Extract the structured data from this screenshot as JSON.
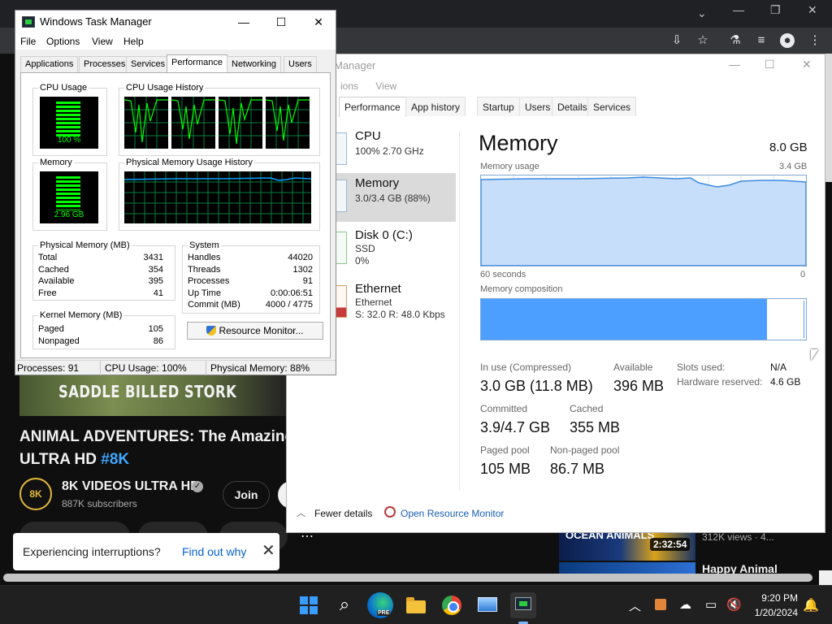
{
  "chrome": {
    "window_controls": [
      "⌄",
      "—",
      "❐",
      "✕"
    ],
    "toolbar_icons": [
      "install-icon",
      "star-icon",
      "lab-icon",
      "playlist-icon",
      "profile-icon",
      "menu-icon"
    ]
  },
  "youtube": {
    "video_caption": "SADDLE BILLED STORK",
    "title_main": "ANIMAL ADVENTURES: The Amazing",
    "title_line2": "ULTRA HD ",
    "title_tag": "#8K",
    "channel_avatar": "8K",
    "channel_name": "8K VIDEOS ULTRA HD",
    "channel_subs": "887K subscribers",
    "join_label": "Join",
    "more_label": "⋯",
    "toast_text": "Experiencing interruptions?",
    "toast_link": "Find out why",
    "rec_thumb_text": "OCEAN ANIMALS",
    "rec_duration": "2:32:54",
    "rec_views": "312K views · 4...",
    "rec_title2": "Happy Animal"
  },
  "tm_modern": {
    "title": "Manager",
    "menu": [
      "ions",
      "View"
    ],
    "tabs": [
      "Performance",
      "App history",
      "Startup",
      "Users",
      "Details",
      "Services"
    ],
    "sidebar": [
      {
        "name": "CPU",
        "sub1": "100%  2.70 GHz",
        "sub2": ""
      },
      {
        "name": "Memory",
        "sub1": "3.0/3.4 GB (88%)",
        "sub2": ""
      },
      {
        "name": "Disk 0 (C:)",
        "sub1": "SSD",
        "sub2": "0%"
      },
      {
        "name": "Ethernet",
        "sub1": "Ethernet",
        "sub2": "S: 32.0  R: 48.0 Kbps"
      }
    ],
    "heading": "Memory",
    "total": "8.0 GB",
    "usage_label": "Memory usage",
    "usage_max": "3.4 GB",
    "x_left": "60 seconds",
    "x_right": "0",
    "composition_label": "Memory composition",
    "composition_in_use_fraction": 0.88,
    "stats": {
      "in_use_label": "In use (Compressed)",
      "in_use_value": "3.0 GB (11.8 MB)",
      "available_label": "Available",
      "available_value": "396 MB",
      "committed_label": "Committed",
      "committed_value": "3.9/4.7 GB",
      "cached_label": "Cached",
      "cached_value": "355 MB",
      "paged_label": "Paged pool",
      "paged_value": "105 MB",
      "nonpaged_label": "Non-paged pool",
      "nonpaged_value": "86.7 MB",
      "slots_label": "Slots used:",
      "slots_value": "N/A",
      "hw_reserved_label": "Hardware reserved:",
      "hw_reserved_value": "4.6 GB"
    },
    "fewer_details": "Fewer details",
    "open_resource_monitor": "Open Resource Monitor"
  },
  "tm_classic": {
    "title": "Windows Task Manager",
    "window_buttons": [
      "—",
      "☐",
      "✕"
    ],
    "menu": [
      "File",
      "Options",
      "View",
      "Help"
    ],
    "tabs": [
      "Applications",
      "Processes",
      "Services",
      "Performance",
      "Networking",
      "Users"
    ],
    "cpu_usage_label": "CPU Usage",
    "cpu_usage_value": "100 %",
    "cpu_history_label": "CPU Usage History",
    "memory_label": "Memory",
    "memory_value": "2.96 GB",
    "mem_history_label": "Physical Memory Usage History",
    "physical_memory": {
      "title": "Physical Memory (MB)",
      "rows": [
        {
          "label": "Total",
          "value": "3431"
        },
        {
          "label": "Cached",
          "value": "354"
        },
        {
          "label": "Available",
          "value": "395"
        },
        {
          "label": "Free",
          "value": "41"
        }
      ]
    },
    "kernel_memory": {
      "title": "Kernel Memory (MB)",
      "rows": [
        {
          "label": "Paged",
          "value": "105"
        },
        {
          "label": "Nonpaged",
          "value": "86"
        }
      ]
    },
    "system": {
      "title": "System",
      "rows": [
        {
          "label": "Handles",
          "value": "44020"
        },
        {
          "label": "Threads",
          "value": "1302"
        },
        {
          "label": "Processes",
          "value": "91"
        },
        {
          "label": "Up Time",
          "value": "0:00:06:51"
        },
        {
          "label": "Commit (MB)",
          "value": "4000 / 4775"
        }
      ]
    },
    "resource_monitor_button": "Resource Monitor...",
    "status": {
      "processes": "Processes: 91",
      "cpu": "CPU Usage: 100%",
      "memory": "Physical Memory: 88%"
    }
  },
  "taskbar": {
    "apps": [
      "start-icon",
      "search-icon",
      "edge-icon",
      "file-explorer-icon",
      "chrome-icon",
      "photos-icon",
      "task-manager-icon"
    ],
    "edge_badge": "PRE",
    "time": "9:20 PM",
    "date": "1/20/2024"
  }
}
